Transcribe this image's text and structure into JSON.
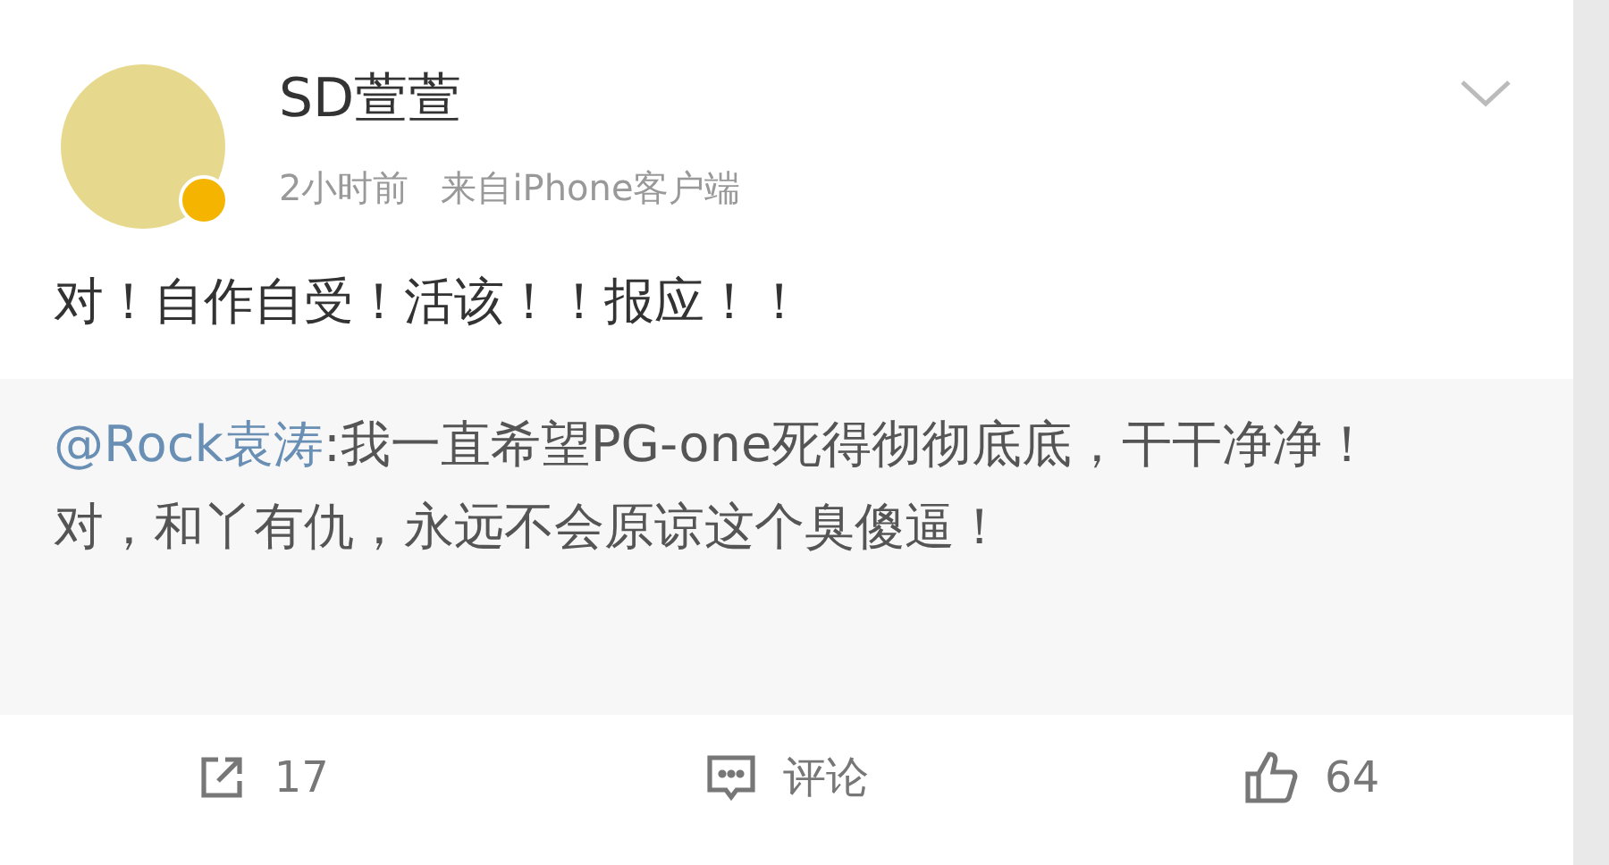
{
  "post": {
    "author": "SD萱萱",
    "verified": true,
    "time": "2小时前",
    "source": "来自iPhone客户端",
    "text": "对！自作自受！活该！！报应！！"
  },
  "repost": {
    "mention": "@Rock袁涛",
    "text": ":我一直希望PG-one死得彻彻底底，干干净净！对，和丫有仇，永远不会原谅这个臭傻逼！"
  },
  "actions": [
    {
      "kind": "share",
      "label": "17"
    },
    {
      "kind": "comment",
      "label": "评论"
    },
    {
      "kind": "like",
      "label": "64"
    }
  ]
}
